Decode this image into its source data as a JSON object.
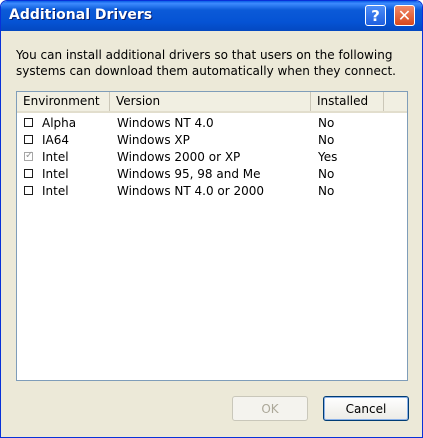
{
  "window": {
    "title": "Additional Drivers"
  },
  "titlebar": {
    "help_glyph": "?",
    "close_glyph": "✕"
  },
  "description": "You can install additional drivers so that users on the following systems can download them automatically when they connect.",
  "table": {
    "columns": [
      "Environment",
      "Version",
      "Installed"
    ],
    "rows": [
      {
        "checked": false,
        "disabled": false,
        "environment": "Alpha",
        "version": "Windows NT 4.0",
        "installed": "No"
      },
      {
        "checked": false,
        "disabled": false,
        "environment": "IA64",
        "version": "Windows XP",
        "installed": "No"
      },
      {
        "checked": true,
        "disabled": true,
        "environment": "Intel",
        "version": "Windows 2000 or XP",
        "installed": "Yes"
      },
      {
        "checked": false,
        "disabled": false,
        "environment": "Intel",
        "version": "Windows 95, 98 and Me",
        "installed": "No"
      },
      {
        "checked": false,
        "disabled": false,
        "environment": "Intel",
        "version": "Windows NT 4.0 or 2000",
        "installed": "No"
      }
    ]
  },
  "buttons": {
    "ok": "OK",
    "cancel": "Cancel"
  },
  "colors": {
    "titlebar": "#0553d4",
    "dialog_bg": "#ece9d8",
    "list_border": "#7f9db9",
    "close_button": "#d8481c"
  }
}
